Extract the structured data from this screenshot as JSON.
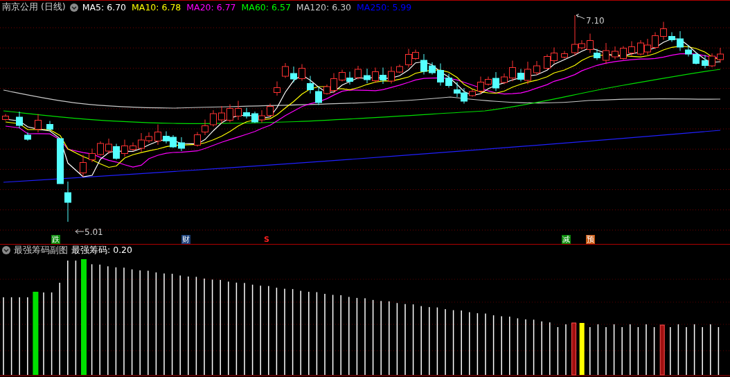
{
  "header": {
    "title": "南京公用 (日线)",
    "indicators": [
      {
        "text": "MA5: 6.70",
        "color": "#ffffff"
      },
      {
        "text": "MA10: 6.78",
        "color": "#ffff00"
      },
      {
        "text": "MA20: 6.77",
        "color": "#ff00ff"
      },
      {
        "text": "MA60: 6.57",
        "color": "#00ff00"
      },
      {
        "text": "MA120: 6.30",
        "color": "#c8c8c8"
      },
      {
        "text": "MA250: 5.99",
        "color": "#0000ff"
      }
    ]
  },
  "price_chart": {
    "high_label": "7.10",
    "low_label": "5.01"
  },
  "event_markers": [
    {
      "text": "跌",
      "color": "#0a8a0a"
    },
    {
      "text": "财",
      "color": "#1a3f7a"
    },
    {
      "text": "S",
      "color": "#ff2020"
    },
    {
      "text": "减",
      "color": "#0a8a0a"
    },
    {
      "text": "预",
      "color": "#c85a14"
    }
  ],
  "sub_panel": {
    "title": "最强筹码副图",
    "reading": "最强筹码: 0.20"
  }
}
